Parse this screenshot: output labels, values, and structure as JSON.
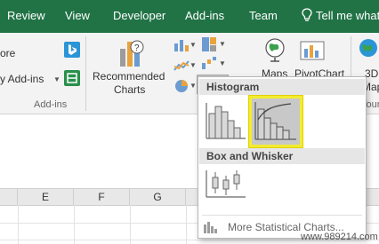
{
  "colors": {
    "accent": "#217346",
    "selection_highlight": "#f3ec2f"
  },
  "tabs": [
    "Review",
    "View",
    "Developer",
    "Add-ins",
    "Team"
  ],
  "tell_me": "Tell me what",
  "ribbon": {
    "store_label": "ore",
    "my_addins_label": "y Add-ins",
    "addins_group_label": "Add-ins",
    "recommended_charts_line1": "Recommended",
    "recommended_charts_line2": "Charts",
    "maps_label": "Maps",
    "pivotchart_label": "PivotChart",
    "map3d_line1": "3D",
    "map3d_line2": "Map",
    "tours_label": "Tour"
  },
  "dropdown": {
    "histogram_header": "Histogram",
    "boxwhisker_header": "Box and Whisker",
    "more_link": "More Statistical Charts..."
  },
  "columns": [
    "E",
    "F",
    "G"
  ],
  "watermark": "www.989214.com"
}
